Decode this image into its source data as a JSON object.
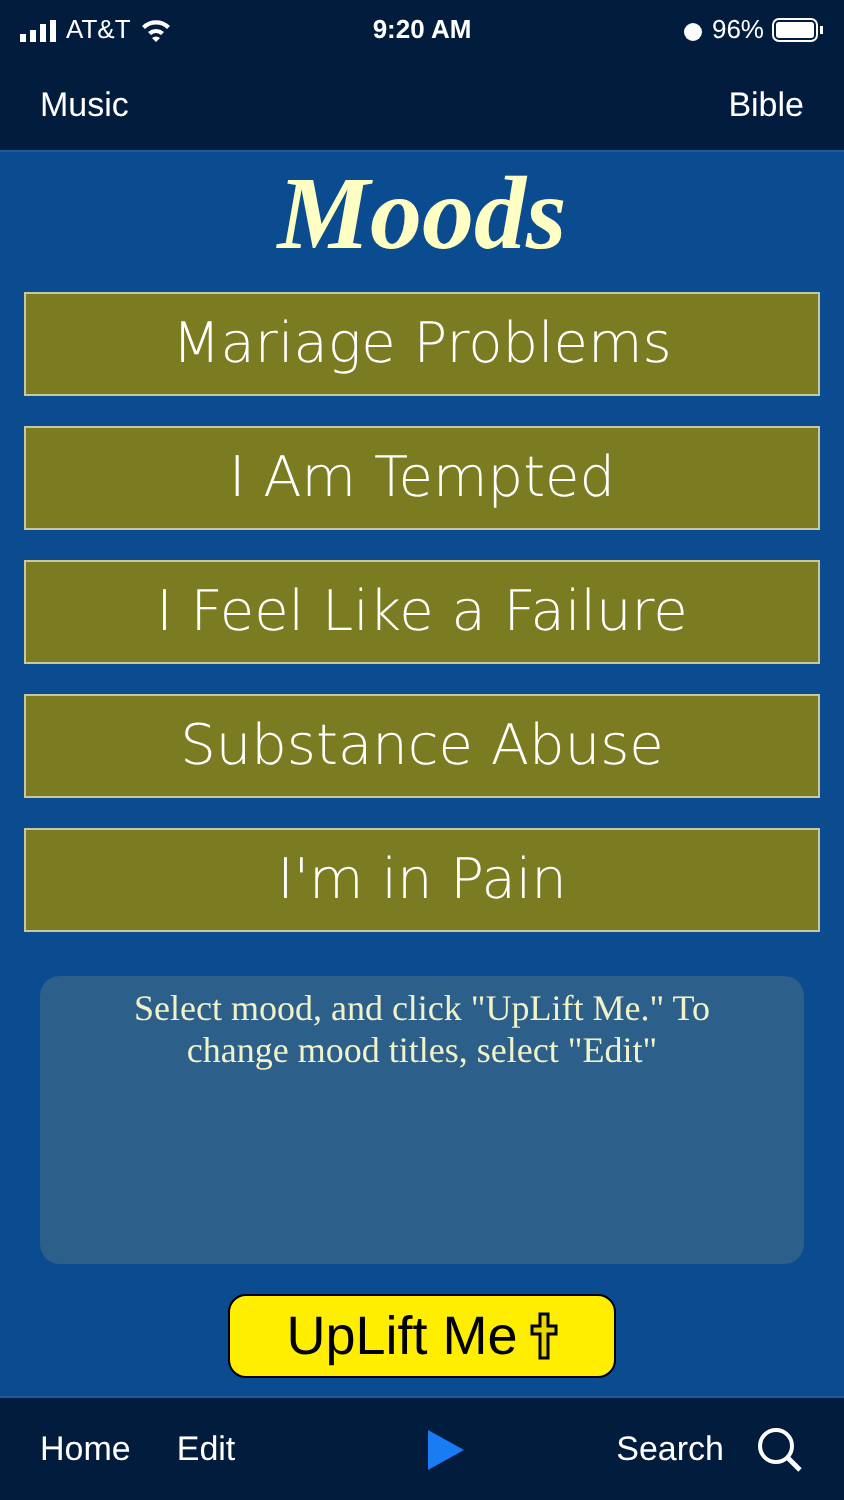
{
  "status_bar": {
    "carrier": "AT&T",
    "time": "9:20 AM",
    "battery": "96%"
  },
  "nav_bar": {
    "left": "Music",
    "right": "Bible"
  },
  "title": "Moods",
  "moods": [
    {
      "label": "Mariage Problems"
    },
    {
      "label": "I Am Tempted"
    },
    {
      "label": "I Feel Like a Failure"
    },
    {
      "label": "Substance Abuse"
    },
    {
      "label": "I'm in Pain"
    }
  ],
  "info_text": "Select mood, and click \"UpLift Me.\" To change mood titles, select \"Edit\"",
  "uplift_button": "UpLift Me",
  "toolbar": {
    "home": "Home",
    "edit": "Edit",
    "search": "Search"
  }
}
